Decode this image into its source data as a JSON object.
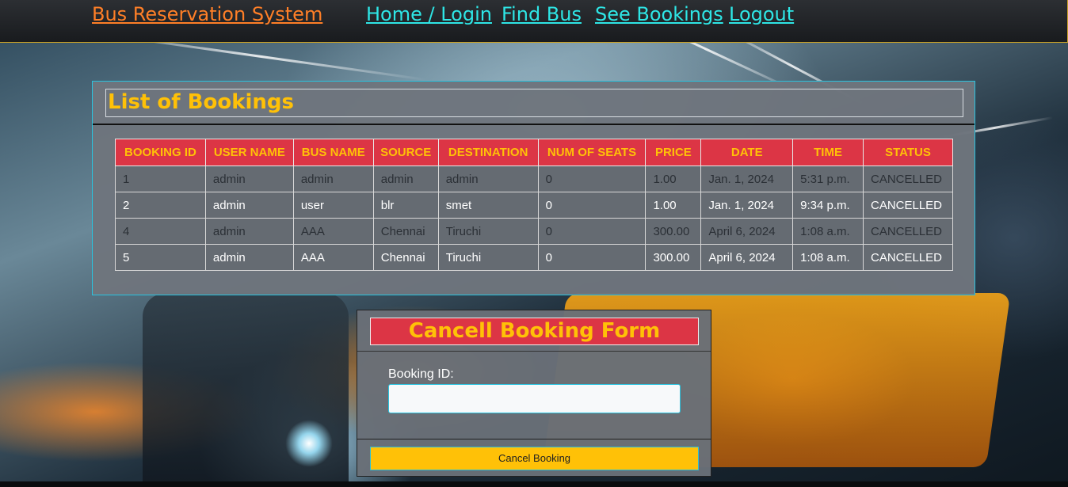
{
  "navbar": {
    "brand": "Bus Reservation System ",
    "links": [
      {
        "label": "Home / Login "
      },
      {
        "label": "Find Bus "
      },
      {
        "label": "See Bookings "
      },
      {
        "label": "Logout "
      }
    ]
  },
  "bookings": {
    "title": "List of Bookings",
    "columns": [
      "BOOKING ID",
      "USER NAME",
      "BUS NAME",
      "SOURCE",
      "DESTINATION",
      "NUM OF SEATS",
      "PRICE",
      "DATE",
      "TIME",
      "STATUS"
    ],
    "rows": [
      [
        "1",
        "admin",
        "admin",
        "admin",
        "admin",
        "0",
        "1.00",
        "Jan. 1, 2024",
        "5:31 p.m.",
        "CANCELLED"
      ],
      [
        "2",
        "admin",
        "user",
        "blr",
        "smet",
        "0",
        "1.00",
        "Jan. 1, 2024",
        "9:34 p.m.",
        "CANCELLED"
      ],
      [
        "4",
        "admin",
        "AAA",
        "Chennai",
        "Tiruchi",
        "0",
        "300.00",
        "April 6, 2024",
        "1:08 a.m.",
        "CANCELLED"
      ],
      [
        "5",
        "admin",
        "AAA",
        "Chennai",
        "Tiruchi",
        "0",
        "300.00",
        "April 6, 2024",
        "1:08 a.m.",
        "CANCELLED"
      ]
    ]
  },
  "cancel_form": {
    "title": "Cancell Booking Form",
    "booking_id_label": "Booking ID:",
    "booking_id_value": "",
    "submit_label": "Cancel Booking"
  },
  "colors": {
    "brand": "#ff7f27",
    "nav_link": "#2ee6e6",
    "accent_yellow": "#ffc107",
    "header_red": "#dc3545",
    "panel_border": "#29c4e0"
  }
}
